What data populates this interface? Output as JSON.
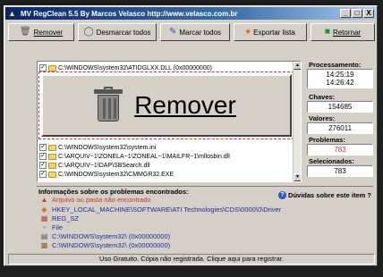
{
  "window": {
    "title": "MV RegClean 5.5  By Marcos Velasco  http://www.velasco.com.br",
    "controls": [
      "_",
      "□",
      "X"
    ]
  },
  "toolbar": {
    "remover": "Remover",
    "desmarcar": "Desmarcar todos",
    "marcar": "Marcar todos",
    "exportar": "Exportar lista",
    "retornar": "Retornar"
  },
  "list": {
    "items": [
      {
        "path": "C:\\WINDOWS\\system32\\ATIDGLXX.DLL (0x00000000)",
        "checked": true
      },
      {
        "path": "C:\\WINDOWS\\system32\\system.ini",
        "checked": true
      },
      {
        "path": "C:\\ARQUIV~1\\ZONELA~1\\ZONEAL~1\\MAILFR~1\\mllosbin.dll",
        "checked": true
      },
      {
        "path": "C:\\ARQUIV~1\\DAP\\SBSearch.dll",
        "checked": true
      },
      {
        "path": "C:\\WINDOWS\\system32\\CMMGR32.EXE",
        "checked": true
      }
    ]
  },
  "big_button": {
    "label": "Remover"
  },
  "side": {
    "processamento_label": "Processamento:",
    "start_time": "14:25:19",
    "end_time": "14:26:42",
    "chaves_label": "Chaves:",
    "chaves_value": "154685",
    "valores_label": "Valores:",
    "valores_value": "276011",
    "problemas_label": "Problemas:",
    "problemas_value": "783",
    "selecionados_label": "Selecionados:",
    "selecionados_value": "783"
  },
  "info": {
    "title": "Informações sobre os problemas encontrados:",
    "help": "Dúvidas sobre este item ?",
    "rows": [
      "Arquivo ou pasta não encontrado",
      "HKEY_LOCAL_MACHINE\\SOFTWARE\\ATI Technologies\\CDS\\0000\\0\\Driver",
      "REG_SZ",
      "File",
      "C:\\WINDOWS\\system32\\ (0x00000000)",
      "C:\\WINDOWS\\system32\\ (0x00000000)"
    ]
  },
  "status": "Uso Gratuito. Cópia não registrada. Clique aqui para registrar.",
  "colors": {
    "accent_red": "#c23a2a",
    "link_blue": "#1c2e9c",
    "problem_red": "#c23a2a"
  }
}
